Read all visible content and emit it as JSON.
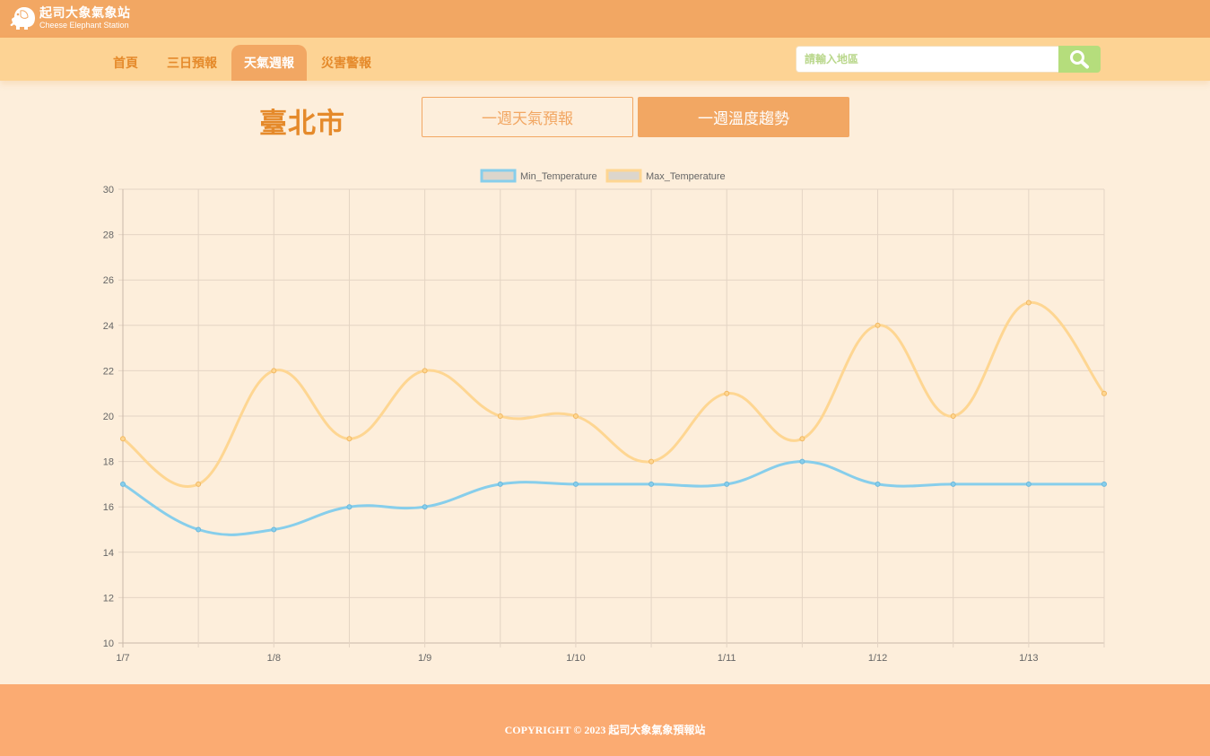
{
  "header": {
    "brand_title": "起司大象氣象站",
    "brand_subtitle": "Cheese Elephant Station"
  },
  "nav": {
    "items": [
      {
        "label": "首頁"
      },
      {
        "label": "三日預報"
      },
      {
        "label": "天氣週報",
        "active": true
      },
      {
        "label": "災害警報"
      }
    ]
  },
  "search": {
    "placeholder": "請輸入地區",
    "button_icon": "search-icon"
  },
  "page": {
    "city": "臺北市",
    "tabs": [
      {
        "label": "一週天氣預報"
      },
      {
        "label": "一週溫度趨勢",
        "active": true
      }
    ]
  },
  "colors": {
    "accent": "#f2a763",
    "nav_bg": "#fdd394",
    "page_bg": "#fdeedb",
    "min_series": "#87ceeb",
    "max_series": "#fed692",
    "footer_bg": "#fbab72",
    "search_btn": "#b5dd7c"
  },
  "chart_data": {
    "type": "line",
    "x_ticks": [
      "1/7",
      "",
      "1/8",
      "",
      "1/9",
      "",
      "1/10",
      "",
      "1/11",
      "",
      "1/12",
      "",
      "1/13",
      ""
    ],
    "y_ticks": [
      10,
      12,
      14,
      16,
      18,
      20,
      22,
      24,
      26,
      28,
      30
    ],
    "ylim": [
      10,
      30
    ],
    "grid": true,
    "legend_position": "top-center",
    "series": [
      {
        "name": "Min_Temperature",
        "color": "#87ceeb",
        "values": [
          17,
          15,
          15,
          16,
          16,
          17,
          17,
          17,
          17,
          18,
          17,
          17,
          17,
          17
        ]
      },
      {
        "name": "Max_Temperature",
        "color": "#fed692",
        "values": [
          19,
          17,
          22,
          19,
          22,
          20,
          20,
          18,
          21,
          19,
          24,
          20,
          25,
          21
        ]
      }
    ]
  },
  "footer": {
    "copyright": "COPYRIGHT © 2023 起司大象氣象預報站"
  }
}
